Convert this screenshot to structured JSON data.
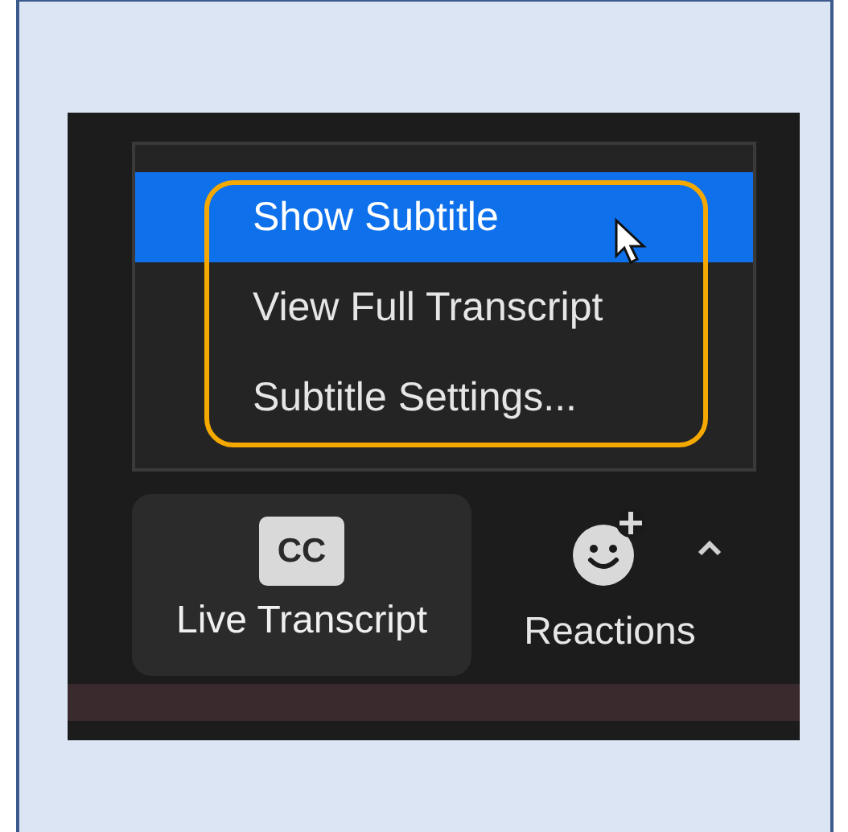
{
  "menu": {
    "items": [
      {
        "label": "Show Subtitle",
        "selected": true
      },
      {
        "label": "View Full Transcript",
        "selected": false
      },
      {
        "label": "Subtitle Settings...",
        "selected": false
      }
    ]
  },
  "toolbar": [
    {
      "kind": "cc",
      "badge": "CC",
      "label": "Live Transcript",
      "selected": true
    },
    {
      "kind": "reactions",
      "label": "Reactions",
      "selected": false
    }
  ]
}
